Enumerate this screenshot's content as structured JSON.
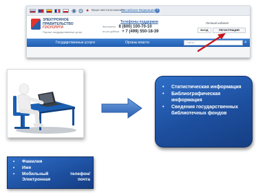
{
  "portal": {
    "location_label": "Ваше местоположение",
    "location_value": "Российская Федерация",
    "help_icon": "?",
    "logo_line1": "ЭЛЕКТРОННОЕ",
    "logo_line2": "ПРАВИТЕЛЬСТВО",
    "logo_line3": "ГОСУСЛУГИ",
    "logo_tagline": "Портал государственных услуг",
    "support_title": "Телефоны поддержки",
    "support_rows": [
      {
        "label": "бесплатно",
        "phone": "8 (800) 100-70-10"
      },
      {
        "label": "из-за рубежа",
        "phone": "+ 7 (499) 550-18-39"
      }
    ],
    "cabinet_label": "Личный кабинет",
    "login_label": "ВХОД",
    "register_label": "РЕГИСТРАЦИЯ",
    "nav": [
      "Государственные услуги",
      "Органы власти"
    ],
    "search_placeholder": "Найти"
  },
  "info_items": [
    "Статистическая информация",
    "Библиографическая информация",
    "Сведения государственных библиотечных фондов"
  ],
  "data_items": [
    "Фамилия",
    "Имя",
    "Мобильный телефон/Электронная почта"
  ],
  "colors": {
    "box_blue": "#1d4f9f",
    "nav_blue": "#2a6cc2",
    "arrow_blue": "#3f78c8",
    "accent_red": "#c8161d"
  },
  "icons": [
    "flag-icon",
    "accessibility-icon",
    "location-pin-icon",
    "help-icon",
    "search-icon",
    "arrow-right-icon",
    "computer-user-icon"
  ]
}
